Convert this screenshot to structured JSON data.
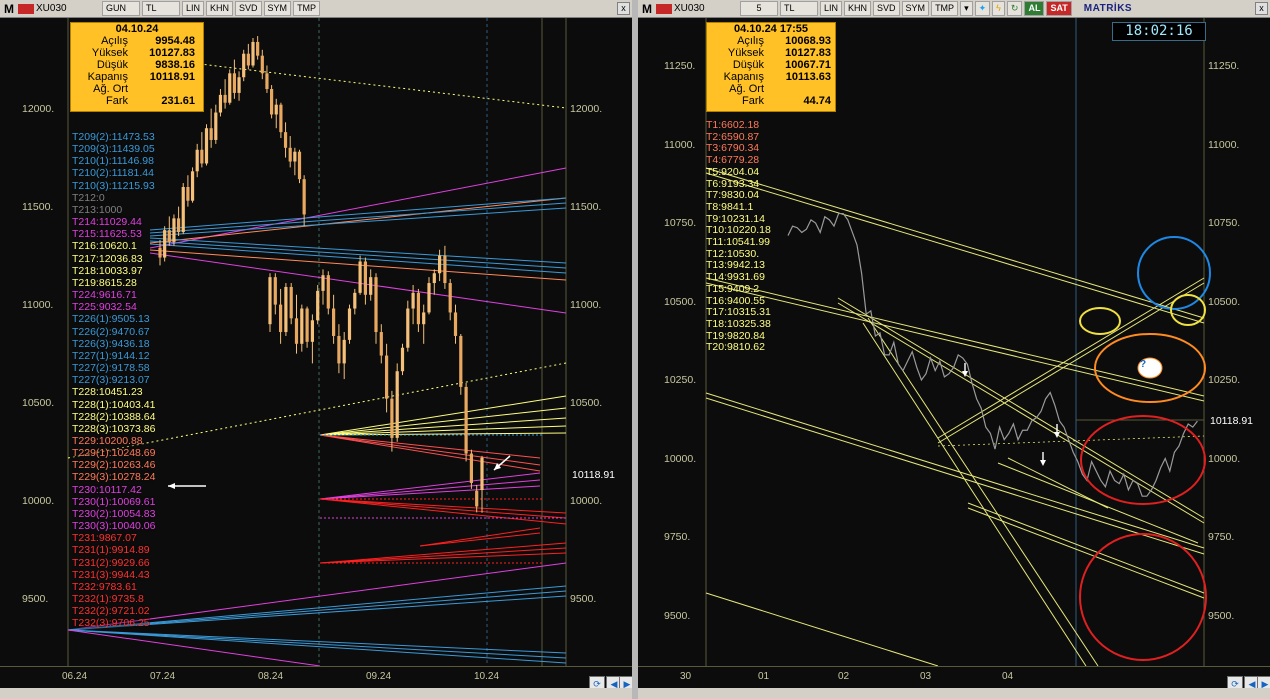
{
  "left_window": {
    "toolbar": {
      "menu": "M",
      "symbol": "XU030",
      "period": "GUN",
      "currency": "TL",
      "buttons": [
        "LIN",
        "KHN",
        "SVD",
        "SYM",
        "TMP"
      ],
      "close": "x"
    },
    "info": {
      "date": "04.10.24",
      "rows": [
        {
          "label": "Açılış",
          "value": "9954.48"
        },
        {
          "label": "Yüksek",
          "value": "10127.83"
        },
        {
          "label": "Düşük",
          "value": "9838.16"
        },
        {
          "label": "Kapanış",
          "value": "10118.91"
        },
        {
          "label": "Ağ. Ort",
          "value": ""
        },
        {
          "label": "Fark",
          "value": "231.61"
        }
      ]
    },
    "levels": [
      {
        "text": "T209(2):11473.53",
        "color": "#3a9ad9"
      },
      {
        "text": "T209(3):11439.05",
        "color": "#3a9ad9"
      },
      {
        "text": "T210(1):11146.98",
        "color": "#3a9ad9"
      },
      {
        "text": "T210(2):11181.44",
        "color": "#3a9ad9"
      },
      {
        "text": "T210(3):11215.93",
        "color": "#3a9ad9"
      },
      {
        "text": "T212:0",
        "color": "#808080"
      },
      {
        "text": "T213:1000",
        "color": "#808080"
      },
      {
        "text": "T214:11029.44",
        "color": "#e040e0"
      },
      {
        "text": "T215:11625.53",
        "color": "#e040e0"
      },
      {
        "text": "T216:10620.1",
        "color": "#ffff80"
      },
      {
        "text": "T217:12036.83",
        "color": "#ffff80"
      },
      {
        "text": "T218:10033.97",
        "color": "#ffff80"
      },
      {
        "text": "T219:8615.28",
        "color": "#ffff80"
      },
      {
        "text": "T224:9616.71",
        "color": "#e040e0"
      },
      {
        "text": "T225:9032.54",
        "color": "#e040e0"
      },
      {
        "text": "T226(1):9505.13",
        "color": "#3a9ad9"
      },
      {
        "text": "T226(2):9470.67",
        "color": "#3a9ad9"
      },
      {
        "text": "T226(3):9436.18",
        "color": "#3a9ad9"
      },
      {
        "text": "T227(1):9144.12",
        "color": "#3a9ad9"
      },
      {
        "text": "T227(2):9178.58",
        "color": "#3a9ad9"
      },
      {
        "text": "T227(3):9213.07",
        "color": "#3a9ad9"
      },
      {
        "text": "T228:10451.23",
        "color": "#ffff80"
      },
      {
        "text": "T228(1):10403.41",
        "color": "#ffff80"
      },
      {
        "text": "T228(2):10388.64",
        "color": "#ffff80"
      },
      {
        "text": "T228(3):10373.86",
        "color": "#ffff80"
      },
      {
        "text": "T229:10200.88",
        "color": "#ff7a5a"
      },
      {
        "text": "T229(1):10248.69",
        "color": "#ff7a5a"
      },
      {
        "text": "T229(2):10263.46",
        "color": "#ff7a5a"
      },
      {
        "text": "T229(3):10278.24",
        "color": "#ff7a5a"
      },
      {
        "text": "T230:10117.42",
        "color": "#e040e0"
      },
      {
        "text": "T230(1):10069.61",
        "color": "#e040e0"
      },
      {
        "text": "T230(2):10054.83",
        "color": "#e040e0"
      },
      {
        "text": "T230(3):10040.06",
        "color": "#e040e0"
      },
      {
        "text": "T231:9867.07",
        "color": "#ff3030"
      },
      {
        "text": "T231(1):9914.89",
        "color": "#ff3030"
      },
      {
        "text": "T231(2):9929.66",
        "color": "#ff3030"
      },
      {
        "text": "T231(3):9944.43",
        "color": "#ff3030"
      },
      {
        "text": "T232:9783.61",
        "color": "#ff3030"
      },
      {
        "text": "T232(1):9735.8",
        "color": "#ff3030"
      },
      {
        "text": "T232(2):9721.02",
        "color": "#ff3030"
      },
      {
        "text": "T232(3):9706.25",
        "color": "#ff3030"
      }
    ],
    "y_axis": [
      "12000.",
      "11500.",
      "11000.",
      "10500.",
      "10000.",
      "9500."
    ],
    "last_price": "10118.91",
    "x_axis": [
      "06.24",
      "07.24",
      "08.24",
      "09.24",
      "10.24"
    ],
    "candles": [
      [
        11190,
        11230,
        11100,
        11140
      ],
      [
        11140,
        11300,
        11120,
        11280
      ],
      [
        11280,
        11350,
        11200,
        11220
      ],
      [
        11220,
        11360,
        11200,
        11340
      ],
      [
        11340,
        11400,
        11250,
        11270
      ],
      [
        11270,
        11520,
        11260,
        11500
      ],
      [
        11500,
        11560,
        11400,
        11430
      ],
      [
        11430,
        11600,
        11420,
        11580
      ],
      [
        11580,
        11720,
        11550,
        11690
      ],
      [
        11690,
        11780,
        11600,
        11620
      ],
      [
        11620,
        11820,
        11610,
        11800
      ],
      [
        11800,
        11900,
        11700,
        11740
      ],
      [
        11740,
        11920,
        11720,
        11880
      ],
      [
        11880,
        12000,
        11860,
        11970
      ],
      [
        11970,
        12050,
        11900,
        11930
      ],
      [
        11930,
        12100,
        11920,
        12080
      ],
      [
        12080,
        12150,
        11950,
        11980
      ],
      [
        11980,
        12090,
        11940,
        12060
      ],
      [
        12060,
        12200,
        12040,
        12180
      ],
      [
        12180,
        12230,
        12100,
        12120
      ],
      [
        12120,
        12260,
        12110,
        12240
      ],
      [
        12240,
        12270,
        12150,
        12170
      ],
      [
        12170,
        12200,
        12050,
        12080
      ],
      [
        12080,
        12120,
        11980,
        12000
      ],
      [
        12000,
        12020,
        11850,
        11870
      ],
      [
        11870,
        11950,
        11800,
        11920
      ],
      [
        11920,
        11930,
        11750,
        11780
      ],
      [
        11780,
        11830,
        11650,
        11700
      ],
      [
        11700,
        11760,
        11600,
        11630
      ],
      [
        11630,
        11700,
        11560,
        11680
      ],
      [
        11680,
        11690,
        11520,
        11540
      ],
      [
        11540,
        11560,
        11300,
        11360
      ],
      [
        10800,
        11060,
        10760,
        11040
      ],
      [
        11040,
        11060,
        10850,
        10900
      ],
      [
        10900,
        10980,
        10700,
        10760
      ],
      [
        10760,
        11010,
        10740,
        10990
      ],
      [
        10990,
        11010,
        10800,
        10830
      ],
      [
        10830,
        10950,
        10650,
        10700
      ],
      [
        10700,
        10900,
        10660,
        10880
      ],
      [
        10880,
        10890,
        10680,
        10710
      ],
      [
        10710,
        10850,
        10600,
        10820
      ],
      [
        10820,
        11000,
        10800,
        10970
      ],
      [
        10970,
        11080,
        10900,
        11050
      ],
      [
        11050,
        11070,
        10850,
        10880
      ],
      [
        10880,
        10950,
        10700,
        10740
      ],
      [
        10740,
        10800,
        10550,
        10600
      ],
      [
        10600,
        10760,
        10520,
        10720
      ],
      [
        10720,
        10900,
        10700,
        10880
      ],
      [
        10880,
        10980,
        10850,
        10960
      ],
      [
        10960,
        11150,
        10950,
        11120
      ],
      [
        11120,
        11140,
        10900,
        10950
      ],
      [
        10950,
        11080,
        10920,
        11040
      ],
      [
        11040,
        11060,
        10700,
        10760
      ],
      [
        10760,
        10800,
        10600,
        10640
      ],
      [
        10640,
        10700,
        10350,
        10420
      ],
      [
        10420,
        10460,
        10150,
        10220
      ],
      [
        10220,
        10600,
        10200,
        10560
      ],
      [
        10560,
        10700,
        10540,
        10680
      ],
      [
        10680,
        10920,
        10660,
        10880
      ],
      [
        10880,
        11000,
        10800,
        10960
      ],
      [
        10960,
        10980,
        10760,
        10800
      ],
      [
        10800,
        10900,
        10700,
        10860
      ],
      [
        10860,
        11040,
        10850,
        11010
      ],
      [
        11010,
        11080,
        10950,
        11060
      ],
      [
        11060,
        11180,
        11020,
        11150
      ],
      [
        11150,
        11200,
        10980,
        11010
      ],
      [
        11010,
        11030,
        10820,
        10860
      ],
      [
        10860,
        10900,
        10700,
        10740
      ],
      [
        10740,
        10750,
        10440,
        10480
      ],
      [
        10480,
        10500,
        10100,
        10140
      ],
      [
        10140,
        10160,
        9960,
        9990
      ],
      [
        9950,
        9980,
        9840,
        9870
      ],
      [
        9954,
        10128,
        9838,
        10119
      ]
    ]
  },
  "right_window": {
    "toolbar": {
      "menu": "M",
      "symbol": "XU030",
      "period": "5",
      "currency": "TL",
      "buttons": [
        "LIN",
        "KHN",
        "SVD",
        "SYM",
        "TMP"
      ],
      "buy": "AL",
      "sell": "SAT",
      "brand": "MATRİKS",
      "close": "x"
    },
    "clock": "18:02:16",
    "info": {
      "date": "04.10.24 17:55",
      "rows": [
        {
          "label": "Açılış",
          "value": "10068.93"
        },
        {
          "label": "Yüksek",
          "value": "10127.83"
        },
        {
          "label": "Düşük",
          "value": "10067.71"
        },
        {
          "label": "Kapanış",
          "value": "10113.63"
        },
        {
          "label": "Ağ. Ort",
          "value": ""
        },
        {
          "label": "Fark",
          "value": "44.74"
        }
      ]
    },
    "targets": [
      {
        "text": "T1:6602.18",
        "color": "#ff7a5a"
      },
      {
        "text": "T2:6590.87",
        "color": "#ff7a5a"
      },
      {
        "text": "T3:6790.34",
        "color": "#ff7a5a"
      },
      {
        "text": "T4:6779.28",
        "color": "#ff7a5a"
      },
      {
        "text": "T5:9204.04",
        "color": "#ffff80"
      },
      {
        "text": "T6:9193.34",
        "color": "#ffff80"
      },
      {
        "text": "T7:9830.04",
        "color": "#ffff80"
      },
      {
        "text": "T8:9841.1",
        "color": "#ffff80"
      },
      {
        "text": "T9:10231.14",
        "color": "#ffff80"
      },
      {
        "text": "T10:10220.18",
        "color": "#ffff80"
      },
      {
        "text": "T11:10541.99",
        "color": "#ffff80"
      },
      {
        "text": "T12:10530.",
        "color": "#ffff80"
      },
      {
        "text": "T13:9942.13",
        "color": "#ffff80"
      },
      {
        "text": "T14:9931.69",
        "color": "#ffff80"
      },
      {
        "text": "T15:9409.2",
        "color": "#ffff80"
      },
      {
        "text": "T16:9400.55",
        "color": "#ffff80"
      },
      {
        "text": "T17:10315.31",
        "color": "#ffff80"
      },
      {
        "text": "T18:10325.38",
        "color": "#ffff80"
      },
      {
        "text": "T19:9820.84",
        "color": "#ffff80"
      },
      {
        "text": "T20:9810.62",
        "color": "#ffff80"
      }
    ],
    "y_axis": [
      "11250.",
      "11000.",
      "10750.",
      "10500.",
      "10250.",
      "10000.",
      "9750.",
      "9500."
    ],
    "last_price": "10118.91",
    "x_axis": [
      "30",
      "01",
      "02",
      "03",
      "04"
    ],
    "question_mark": "?",
    "price_path": [
      [
        10710,
        10740
      ],
      [
        10735,
        10720
      ],
      [
        10730,
        10760
      ],
      [
        10750,
        10720
      ],
      [
        10770,
        10760
      ],
      [
        10740,
        10780
      ],
      [
        10780,
        10760
      ],
      [
        10720,
        10680
      ],
      [
        10590,
        10460
      ],
      [
        10470,
        10390
      ],
      [
        10400,
        10330
      ],
      [
        10330,
        10370
      ],
      [
        10300,
        10280
      ],
      [
        10310,
        10340
      ],
      [
        10290,
        10250
      ],
      [
        10270,
        10320
      ],
      [
        10280,
        10310
      ],
      [
        10260,
        10270
      ],
      [
        10290,
        10330
      ],
      [
        10320,
        10300
      ],
      [
        10240,
        10190
      ],
      [
        10160,
        10100
      ],
      [
        10080,
        10030
      ],
      [
        10100,
        10060
      ],
      [
        10080,
        10110
      ],
      [
        10060,
        10090
      ],
      [
        10090,
        10120
      ],
      [
        10130,
        10150
      ],
      [
        10190,
        10210
      ],
      [
        10170,
        10120
      ],
      [
        10100,
        10060
      ],
      [
        10020,
        9990
      ],
      [
        9950,
        9930
      ],
      [
        9990,
        9960
      ],
      [
        9930,
        9910
      ],
      [
        9960,
        9930
      ],
      [
        9920,
        9950
      ],
      [
        9900,
        9930
      ],
      [
        9920,
        9880
      ],
      [
        9880,
        9900
      ],
      [
        9930,
        9970
      ],
      [
        10000,
        9960
      ],
      [
        10020,
        10040
      ],
      [
        10080,
        10110
      ],
      [
        10100,
        10119
      ]
    ]
  }
}
